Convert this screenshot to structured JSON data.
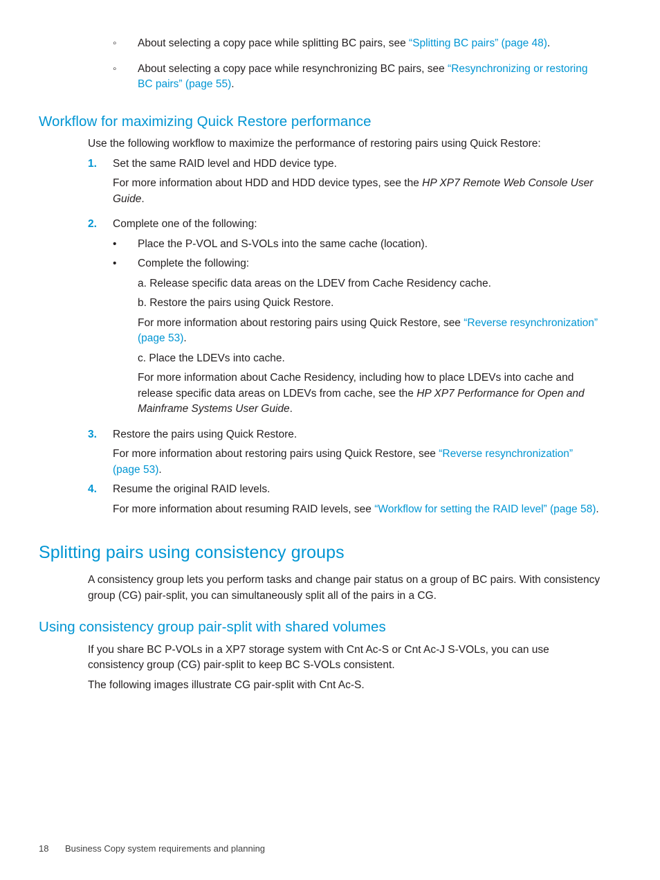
{
  "document": {
    "accent_color": "#0095d3",
    "text_color": "#231f20"
  },
  "top_bullets": {
    "marker": "◦",
    "items": [
      {
        "lead": "About selecting a copy pace while splitting BC pairs, see ",
        "link": "“Splitting BC pairs” (page 48)",
        "tail": "."
      },
      {
        "lead": "About selecting a copy pace while resynchronizing BC pairs, see ",
        "link": "“Resynchronizing or restoring BC pairs” (page 55)",
        "tail": "."
      }
    ]
  },
  "section_workflow": {
    "heading": "Workflow for maximizing Quick Restore performance",
    "intro": "Use the following workflow to maximize the performance of restoring pairs using Quick Restore:",
    "steps": [
      {
        "marker": "1.",
        "text": "Set the same RAID level and HDD device type.",
        "note_lead": "For more information about HDD and HDD device types, see the ",
        "note_italic": "HP XP7 Remote Web Console User Guide",
        "note_tail": "."
      },
      {
        "marker": "2.",
        "text": "Complete one of the following:"
      },
      {
        "marker": "3.",
        "text": "Restore the pairs using Quick Restore.",
        "note_lead": "For more information about restoring pairs using Quick Restore, see ",
        "note_link": "“Reverse resynchronization” (page 53)",
        "note_tail": "."
      },
      {
        "marker": "4.",
        "text": "Resume the original RAID levels.",
        "note_lead": "For more information about resuming RAID levels, see ",
        "note_link": "“Workflow for setting the RAID level” (page 58)",
        "note_tail": "."
      }
    ],
    "step2_bullets": {
      "marker": "•",
      "items": [
        {
          "text": "Place the P-VOL and S-VOLs into the same cache (location)."
        },
        {
          "text": "Complete the following:"
        }
      ]
    },
    "step2_sub": {
      "a": "a. Release specific data areas on the LDEV from Cache Residency cache.",
      "b": "b. Restore the pairs using Quick Restore.",
      "b_note_lead": "For more information about restoring pairs using Quick Restore, see ",
      "b_note_link": "“Reverse resynchronization” (page 53)",
      "b_note_tail": ".",
      "c": "c. Place the LDEVs into cache.",
      "c_note_lead": "For more information about Cache Residency, including how to place LDEVs into cache and release specific data areas on LDEVs from cache, see the ",
      "c_note_italic": "HP XP7 Performance for Open and Mainframe Systems User Guide",
      "c_note_tail": "."
    }
  },
  "section_splitting": {
    "heading": "Splitting pairs using consistency groups",
    "paragraph": "A consistency group lets you perform tasks and change pair status on a group of BC pairs. With consistency group (CG) pair-split, you can simultaneously split all of the pairs in a CG.",
    "subsection": {
      "heading": "Using consistency group pair-split with shared volumes",
      "paragraph_1": "If you share BC P-VOLs in a XP7 storage system with Cnt Ac-S or Cnt Ac-J S-VOLs, you can use consistency group (CG) pair-split to keep BC S-VOLs consistent.",
      "paragraph_2": "The following images illustrate CG pair-split with Cnt Ac-S."
    }
  },
  "footer": {
    "page_number": "18",
    "chapter_title": "Business Copy system requirements and planning"
  }
}
